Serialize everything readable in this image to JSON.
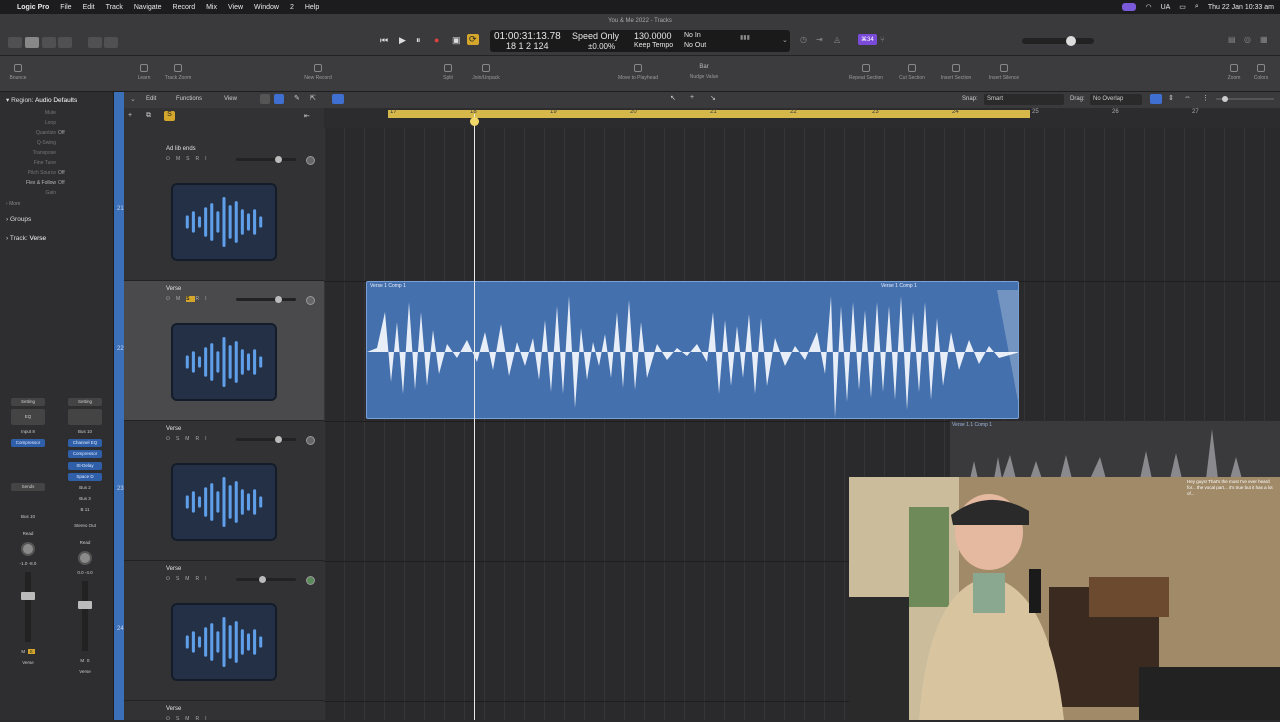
{
  "menubar": {
    "apple": "",
    "app_name": "Logic Pro",
    "items": [
      "File",
      "Edit",
      "Track",
      "Navigate",
      "Record",
      "Mix",
      "View",
      "Window",
      "2",
      "Help"
    ],
    "status_text": "UA",
    "clock": "Thu 22 Jan 10:33 am"
  },
  "window_title": "You & Me 2022 - Tracks",
  "lcd": {
    "time": "01:00:31:13.78",
    "bars": "18  1  2  124",
    "mode": "Speed Only",
    "pitch": "±0.00%",
    "tempo": "130.0000",
    "keep": "Keep Tempo",
    "in": "No In",
    "out": "No Out"
  },
  "badge": "⌘34",
  "toolbar": {
    "items": [
      "Bounce",
      "Learn",
      "Track Zoom",
      "New Record",
      "Split",
      "Join/Unpack",
      "Move to Playhead",
      "Nudge Value",
      "Repeat Section",
      "Cut Section",
      "Insert Section",
      "Insert Silence",
      "Zoom",
      "Colors"
    ],
    "nudge": "Bar"
  },
  "inspector": {
    "region_label": "Region:",
    "region_value": "Audio Defaults",
    "params": [
      {
        "k": "Mute",
        "v": ""
      },
      {
        "k": "Loop",
        "v": ""
      },
      {
        "k": "Quantize",
        "v": "Off"
      },
      {
        "k": "Q-Swing",
        "v": ""
      },
      {
        "k": "Transpose",
        "v": ""
      },
      {
        "k": "Fine Tune",
        "v": ""
      },
      {
        "k": "Pitch Source",
        "v": "Off"
      },
      {
        "k": "Flex & Follow",
        "v": "Off"
      },
      {
        "k": "Gain",
        "v": ""
      }
    ],
    "more": "More",
    "groups": "Groups",
    "track_label": "Track:",
    "track_value": "Verse",
    "strip1": {
      "setting": "Setting",
      "eq": "EQ",
      "input": "Input 8",
      "insert1": "Compressor",
      "sends": "Sends",
      "out": "Bus 10",
      "read": "Read",
      "vals": "-1.0  -8.0",
      "mute": "M",
      "solo": "S",
      "name": "Verse"
    },
    "strip2": {
      "setting": "Setting",
      "input": "Bus 10",
      "insert1": "Channel EQ",
      "insert2": "Compressor",
      "send_a": "St-Delay",
      "send_b": "Space D",
      "bus2": "Bus 2",
      "bus3": "Bus 3",
      "b11": "B 11",
      "out": "Stereo Out",
      "read": "Read",
      "vals": "0.0  -4.0",
      "mute": "M",
      "solo": "S",
      "name": "Verse"
    }
  },
  "arrange_header": {
    "edit": "Edit",
    "functions": "Functions",
    "view": "View",
    "snap_label": "Snap:",
    "snap_value": "Smart",
    "drag_label": "Drag:",
    "drag_value": "No Overlap"
  },
  "tracks": [
    {
      "num": "21",
      "name": "Ad lib ends"
    },
    {
      "num": "22",
      "name": "Verse"
    },
    {
      "num": "23",
      "name": "Verse"
    },
    {
      "num": "24",
      "name": "Verse"
    },
    {
      "num": "",
      "name": "Verse"
    }
  ],
  "ruler": [
    "17",
    "18",
    "19",
    "20",
    "21",
    "22",
    "23",
    "24",
    "25",
    "26",
    "27"
  ],
  "regions": {
    "main_label": "Verse 1 Comp 1",
    "main_label_right": "Verse 1 Comp 1",
    "lower_label": "Verse 1.1 Comp 1"
  },
  "chat": "Hey guys! That's the most I've ever heard for... the vocal part... it's true but it has a lot of..."
}
